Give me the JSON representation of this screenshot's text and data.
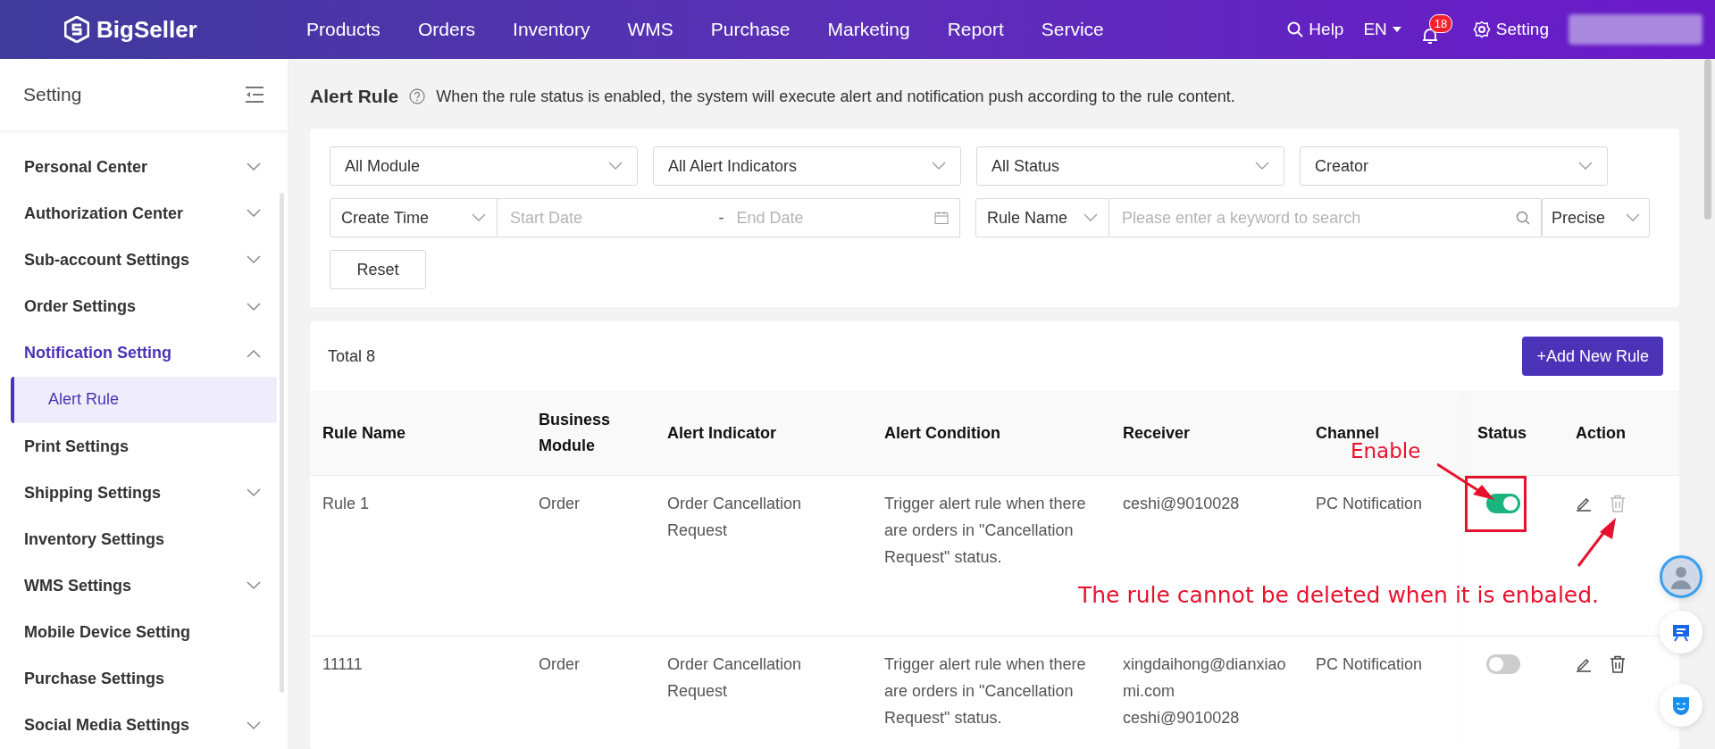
{
  "top_bar": {
    "logo": "BigSeller",
    "nav": [
      "Products",
      "Orders",
      "Inventory",
      "WMS",
      "Purchase",
      "Marketing",
      "Report",
      "Service"
    ],
    "help": "Help",
    "language": "EN",
    "notifications": "18",
    "setting": "Setting"
  },
  "sidebar": {
    "title": "Setting",
    "items": [
      {
        "label": "Personal Center",
        "kind": "group",
        "expanded": false,
        "active": false
      },
      {
        "label": "Authorization Center",
        "kind": "group",
        "expanded": false,
        "active": false
      },
      {
        "label": "Sub-account Settings",
        "kind": "group",
        "expanded": false,
        "active": false
      },
      {
        "label": "Order Settings",
        "kind": "group",
        "expanded": false,
        "active": false
      },
      {
        "label": "Notification Setting",
        "kind": "group",
        "expanded": true,
        "active": true,
        "children": [
          {
            "label": "Alert Rule",
            "selected": true
          }
        ]
      },
      {
        "label": "Print Settings",
        "kind": "link",
        "active": false
      },
      {
        "label": "Shipping Settings",
        "kind": "group",
        "expanded": false,
        "active": false
      },
      {
        "label": "Inventory Settings",
        "kind": "link",
        "active": false
      },
      {
        "label": "WMS Settings",
        "kind": "group",
        "expanded": false,
        "active": false
      },
      {
        "label": "Mobile Device Setting",
        "kind": "link",
        "active": false
      },
      {
        "label": "Purchase Settings",
        "kind": "link",
        "active": false
      },
      {
        "label": "Social Media Settings",
        "kind": "group",
        "expanded": false,
        "active": false
      }
    ]
  },
  "page": {
    "title": "Alert Rule",
    "hint": "When the rule status is enabled, the system will execute alert and notification push according to the rule content."
  },
  "filters": {
    "selects": [
      "All Module",
      "All Alert Indicators",
      "All Status",
      "Creator"
    ],
    "time_type": "Create Time",
    "start_date": {
      "placeholder": "Start Date"
    },
    "date_separator": "-",
    "end_date": {
      "placeholder": "End Date"
    },
    "search_type": "Rule Name",
    "search": {
      "placeholder": "Please enter a keyword to search"
    },
    "match": "Precise",
    "reset": "Reset"
  },
  "table": {
    "total": "Total 8",
    "add_button": "+Add New Rule",
    "columns": [
      "Rule Name",
      "Business Module",
      "Alert Indicator",
      "Alert Condition",
      "Receiver",
      "Channel",
      "Status",
      "Action"
    ],
    "rows": [
      {
        "rule_name": "Rule 1",
        "module": "Order",
        "indicator": "Order Cancellation Request",
        "condition": "Trigger alert rule when there are orders in \"Cancellation Request\" status.",
        "receivers": [
          "ceshi@9010028"
        ],
        "channel": "PC Notification",
        "enabled": true,
        "delete_disabled": true
      },
      {
        "rule_name": "11111",
        "module": "Order",
        "indicator": "Order Cancellation Request",
        "condition": "Trigger alert rule when there are orders in \"Cancellation Request\" status.",
        "receivers": [
          "xingdaihong@dianxiaomi.com",
          "ceshi@9010028"
        ],
        "channel": "PC Notification",
        "enabled": false,
        "delete_disabled": false
      }
    ]
  },
  "annotations": [
    {
      "kind": "label",
      "text": "Enable"
    },
    {
      "kind": "note",
      "text": "The rule cannot be deleted when it is enbaled."
    }
  ]
}
